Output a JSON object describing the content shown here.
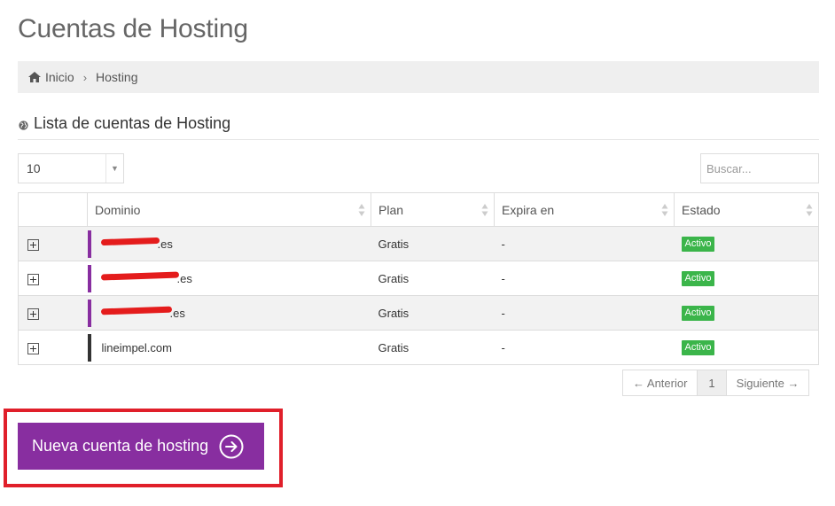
{
  "page": {
    "title": "Cuentas de Hosting"
  },
  "breadcrumb": {
    "home_label": "Inicio",
    "separator": "›",
    "current": "Hosting"
  },
  "section": {
    "title": "Lista de cuentas de Hosting"
  },
  "controls": {
    "page_length": "10",
    "search_placeholder": "Buscar..."
  },
  "table": {
    "columns": [
      "",
      "Dominio",
      "Plan",
      "Expira en",
      "Estado"
    ],
    "rows": [
      {
        "domain": ".es",
        "plan": "Gratis",
        "expires": "-",
        "status": "Activo"
      },
      {
        "domain": ".es",
        "plan": "Gratis",
        "expires": "-",
        "status": "Activo"
      },
      {
        "domain": ".es",
        "plan": "Gratis",
        "expires": "-",
        "status": "Activo"
      },
      {
        "domain": "lineimpel.com",
        "plan": "Gratis",
        "expires": "-",
        "status": "Activo"
      }
    ]
  },
  "pagination": {
    "prev": "← Anterior",
    "page": "1",
    "next": "Siguiente →"
  },
  "cta": {
    "label": "Nueva cuenta de hosting"
  },
  "colors": {
    "accent": "#882ea0",
    "status_active": "#3bb54a",
    "highlight": "#e01f2a",
    "redaction": "#e41c1c"
  },
  "icons": {
    "home": "home-icon",
    "globe": "globe-icon",
    "sort": "sort-icon",
    "expand": "expand-icon",
    "arrow": "arrow-circle-right-icon"
  }
}
